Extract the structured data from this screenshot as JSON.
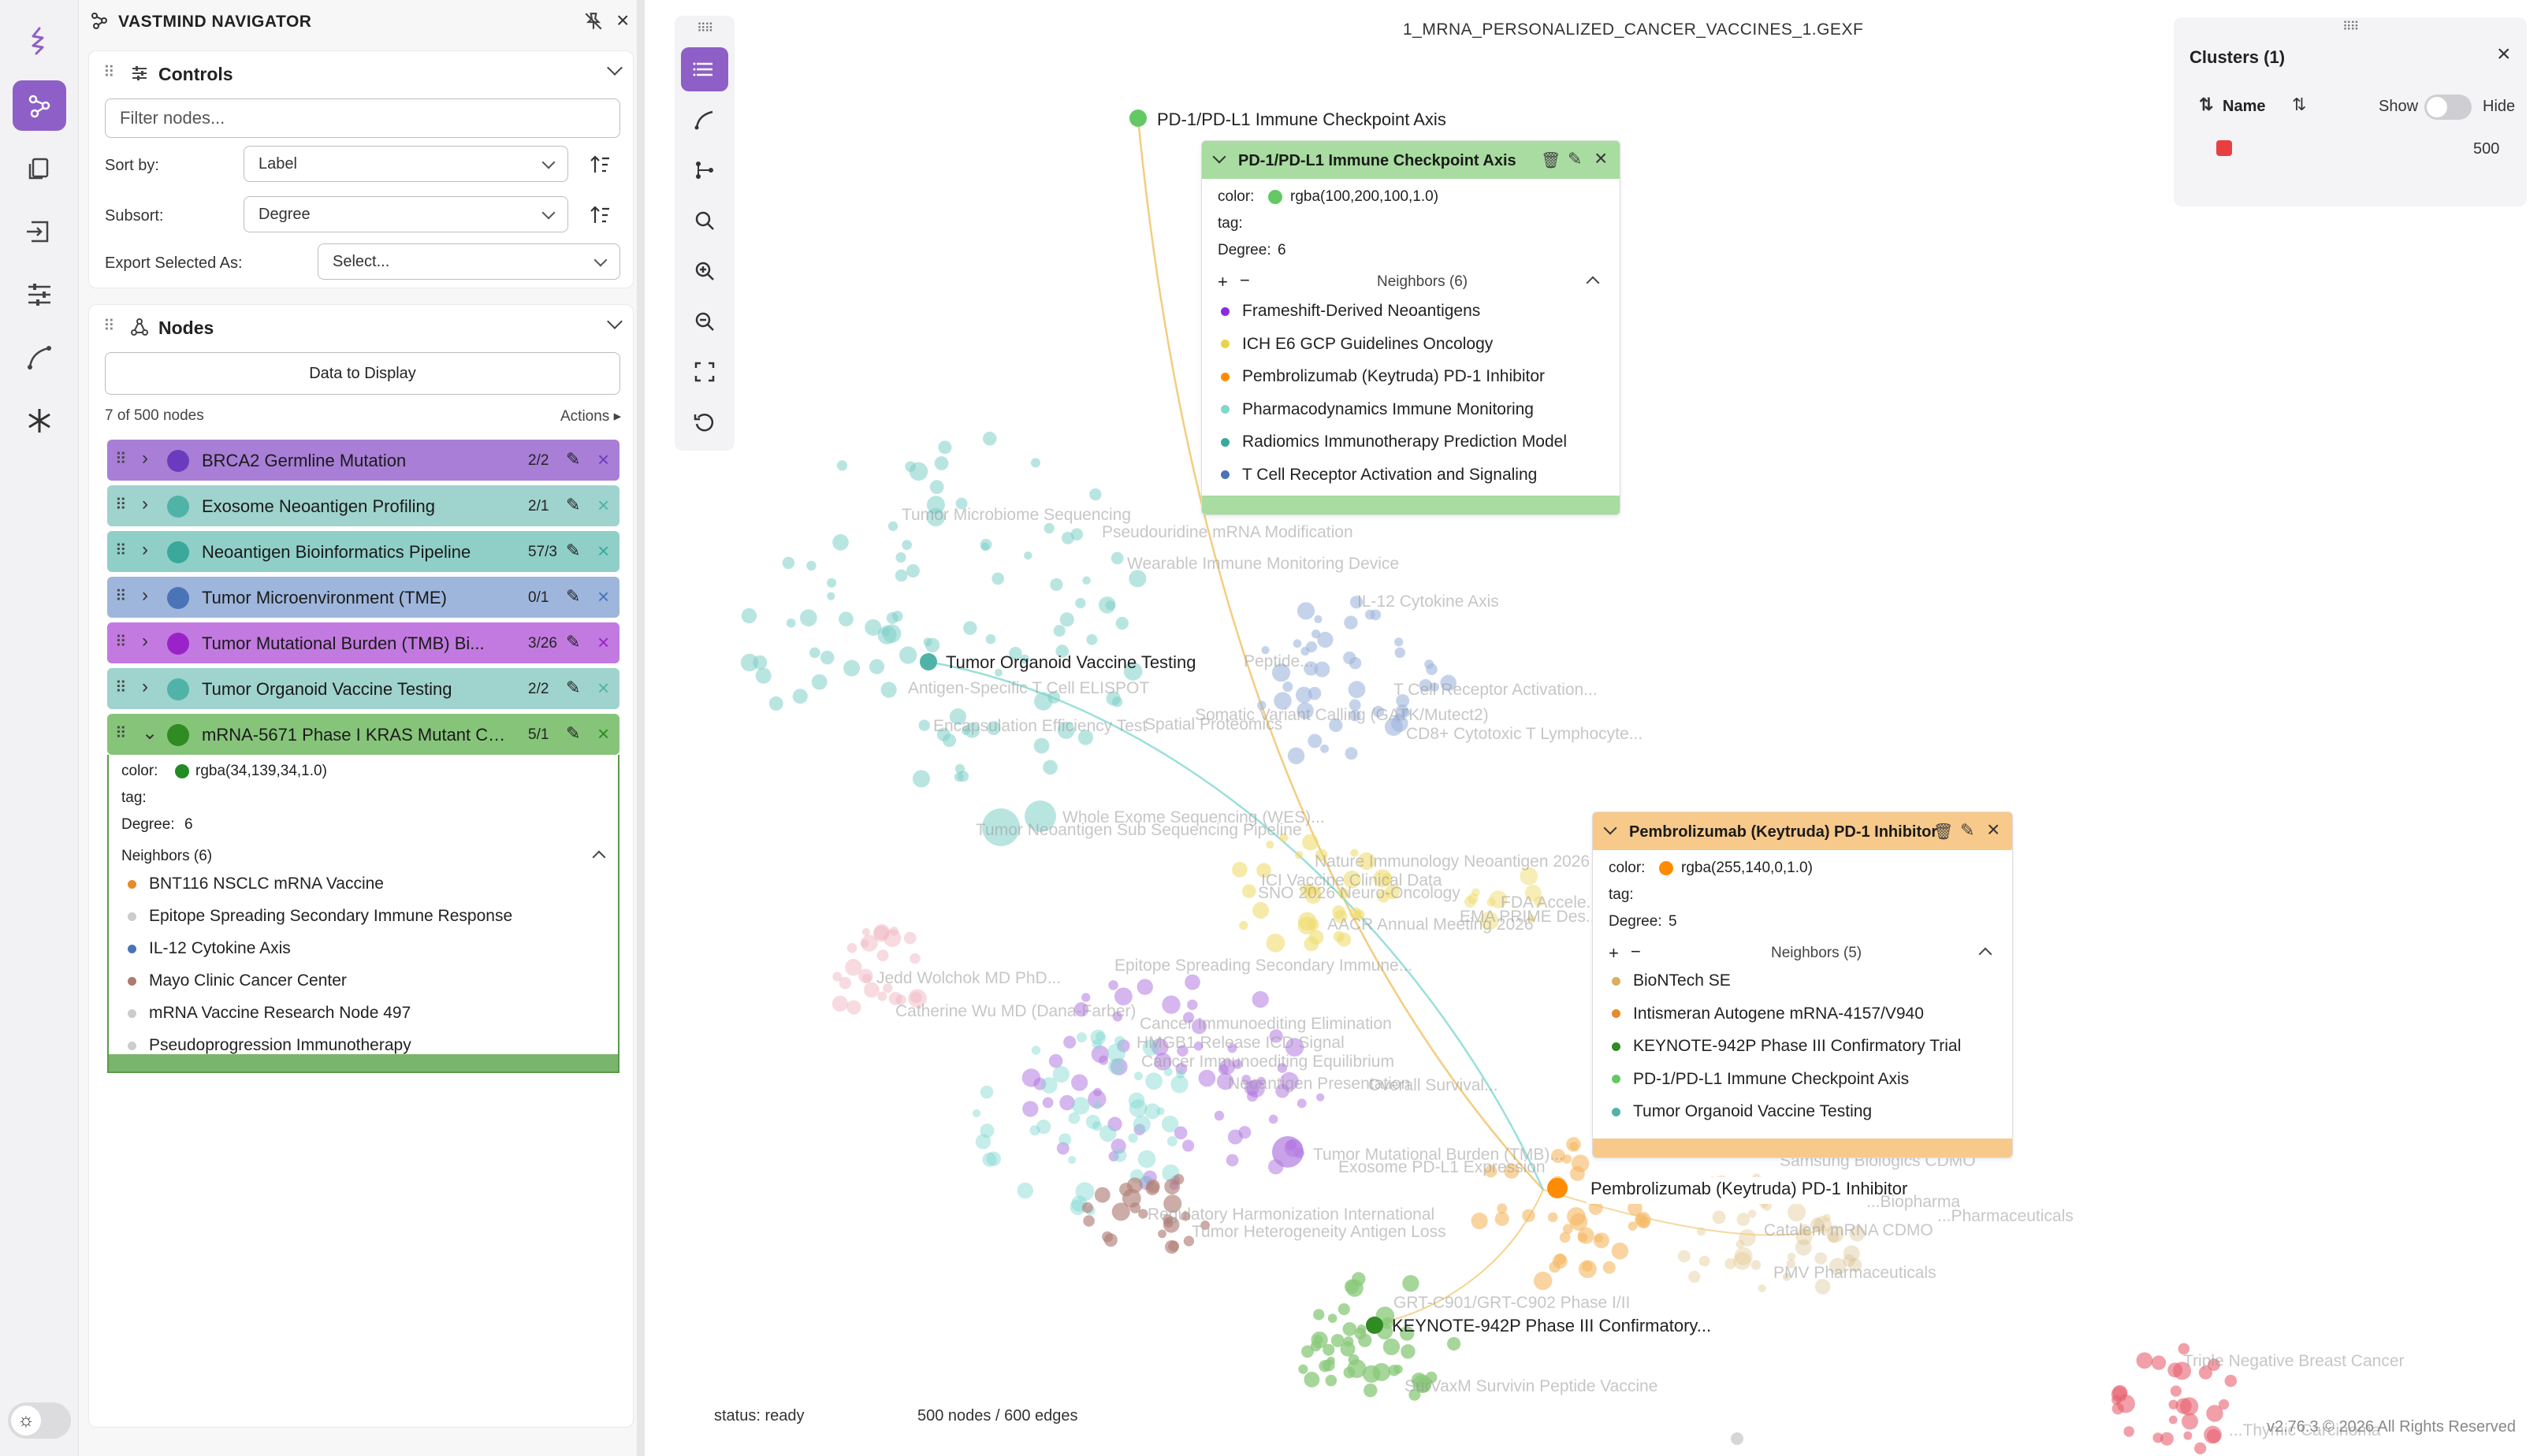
{
  "app": {
    "name": "VASTMIND NAVIGATOR",
    "file_title": "1_MRNA_PERSONALIZED_CANCER_VACCINES_1.GEXF",
    "status": "status: ready",
    "counts": "500 nodes / 600 edges",
    "copyright": "v2.76.3 © 2026 All Rights Reserved"
  },
  "rail": [
    "logo-icon",
    "graph-icon",
    "copy-icon",
    "import-icon",
    "sliders-icon",
    "curve-icon",
    "asterisk-icon"
  ],
  "controls": {
    "title": "Controls",
    "filter_placeholder": "Filter nodes...",
    "sort_by_label": "Sort by:",
    "sort_by_value": "Label",
    "subsort_label": "Subsort:",
    "subsort_value": "Degree",
    "export_label": "Export Selected As:",
    "export_value": "Select..."
  },
  "nodes_panel": {
    "title": "Nodes",
    "data_button": "Data to Display",
    "count_text": "7 of 500 nodes",
    "actions": "Actions ▸",
    "rows": [
      {
        "name": "BRCA2 Germline Mutation",
        "count": "2/2",
        "bg": "#a87ed6",
        "dot": "#6b3bbf",
        "x": "#6b3bbf"
      },
      {
        "name": "Exosome Neoantigen Profiling",
        "count": "2/1",
        "bg": "#9fd3cd",
        "dot": "#4fb3a8",
        "x": "#4fb3a8"
      },
      {
        "name": "Neoantigen Bioinformatics Pipeline",
        "count": "57/3",
        "bg": "#8fcfc8",
        "dot": "#3aa89b",
        "x": "#3aa89b"
      },
      {
        "name": "Tumor Microenvironment (TME)",
        "count": "0/1",
        "bg": "#9fb6dc",
        "dot": "#4a73b8",
        "x": "#4a73b8"
      },
      {
        "name": "Tumor Mutational Burden (TMB) Bi...",
        "count": "3/26",
        "bg": "#c27ae0",
        "dot": "#9a22c9",
        "x": "#9a22c9"
      },
      {
        "name": "Tumor Organoid Vaccine Testing",
        "count": "2/2",
        "bg": "#9fd3cd",
        "dot": "#4fb3a8",
        "x": "#4fb3a8"
      },
      {
        "name": "mRNA-5671 Phase I KRAS Mutant Ca...",
        "count": "5/1",
        "bg": "#86c47a",
        "dot": "#2f8b22",
        "x": "#2f8b22"
      }
    ],
    "detail": {
      "color_label": "color:",
      "color_value": "rgba(34,139,34,1.0)",
      "tag_label": "tag:",
      "degree_label": "Degree:",
      "degree_value": "6",
      "neighbors_title": "Neighbors (6)",
      "neighbors": [
        {
          "name": "BNT116 NSCLC mRNA Vaccine",
          "color": "#e88a2b"
        },
        {
          "name": "Epitope Spreading Secondary Immune Response",
          "color": "#cccccc"
        },
        {
          "name": "IL-12 Cytokine Axis",
          "color": "#4a73b8"
        },
        {
          "name": "Mayo Clinic Cancer Center",
          "color": "#b07a70"
        },
        {
          "name": "mRNA Vaccine Research Node 497",
          "color": "#cccccc"
        },
        {
          "name": "Pseudoprogression Immunotherapy",
          "color": "#cccccc"
        }
      ]
    }
  },
  "popup_pd1": {
    "title": "PD-1/PD-L1 Immune Checkpoint Axis",
    "color_label": "color:",
    "color_value": "rgba(100,200,100,1.0)",
    "tag_label": "tag:",
    "degree_label": "Degree:",
    "degree_value": "6",
    "neighbors_title": "Neighbors (6)",
    "neighbors": [
      {
        "name": "Frameshift-Derived Neoantigens",
        "color": "#8a2be2"
      },
      {
        "name": "ICH E6 GCP Guidelines Oncology",
        "color": "#e8d44a"
      },
      {
        "name": "Pembrolizumab (Keytruda) PD-1 Inhibitor",
        "color": "#ff8c00"
      },
      {
        "name": "Pharmacodynamics Immune Monitoring",
        "color": "#7fd8d0"
      },
      {
        "name": "Radiomics Immunotherapy Prediction Model",
        "color": "#3aa89b"
      },
      {
        "name": "T Cell Receptor Activation and Signaling",
        "color": "#4a73b8"
      }
    ]
  },
  "popup_pembro": {
    "title": "Pembrolizumab (Keytruda) PD-1 Inhibitor",
    "color_label": "color:",
    "color_value": "rgba(255,140,0,1.0)",
    "tag_label": "tag:",
    "degree_label": "Degree:",
    "degree_value": "5",
    "neighbors_title": "Neighbors (5)",
    "neighbors": [
      {
        "name": "BioNTech SE",
        "color": "#d8b060"
      },
      {
        "name": "Intismeran Autogene mRNA-4157/V940",
        "color": "#e88a2b"
      },
      {
        "name": "KEYNOTE-942P Phase III Confirmatory Trial",
        "color": "#2f8b22"
      },
      {
        "name": "PD-1/PD-L1 Immune Checkpoint Axis",
        "color": "#64c864"
      },
      {
        "name": "Tumor Organoid Vaccine Testing",
        "color": "#4fb3a8"
      }
    ]
  },
  "clusters": {
    "title": "Clusters (1)",
    "name_col": "Name",
    "show": "Show",
    "hide": "Hide",
    "value": "500",
    "swatch": "#e84040"
  },
  "graph_labels": {
    "pd1": "PD-1/PD-L1 Immune Checkpoint Axis",
    "organoid": "Tumor Organoid Vaccine Testing",
    "pembro": "Pembrolizumab (Keytruda) PD-1 Inhibitor",
    "keynote": "KEYNOTE-942P Phase III Confirmatory...",
    "faint": [
      "Tumor Microbiome Sequencing",
      "Pseudouridine mRNA Modification",
      "Wearable Immune Monitoring Device",
      "IL-12 Cytokine Axis",
      "Antigen-Specific T Cell ELISPOT",
      "Peptide...",
      "Encapsulation Efficiency Test",
      "Spatial Proteomics",
      "Somatic Variant Calling (GATK/Mutect2)",
      "T Cell Receptor Activation...",
      "CD8+ Cytotoxic T Lymphocyte...",
      "Whole Exome Sequencing (WES)...",
      "Tumor Neoantigen Sub Sequencing Pipeline",
      "Nature Immunology Neoantigen 2026",
      "ICI Vaccine Clinical Data",
      "SNO 2026 Neuro-Oncology",
      "AACR Annual Meeting 2026",
      "FDA Accele...",
      "EMA PRIME Des...",
      "Jedd Wolchok MD PhD...",
      "Catherine Wu MD (Dana-Farber)",
      "Epitope Spreading Secondary Immune...",
      "Cancer Immunoediting Elimination",
      "HMGB1 Release ICD Signal",
      "Cancer Immunoediting Equilibrium",
      "Neoantigen Presentation",
      "Overall Survival...",
      "Tumor Mutational Burden (TMB)...",
      "Exosome PD-L1 Expression",
      "Regulatory Harmonization International",
      "Tumor Heterogeneity Antigen Loss",
      "Samsung Biologics CDMO",
      "...Biopharma",
      "...Pharmaceuticals",
      "Catalent mRNA CDMO",
      "PMV Pharmaceuticals",
      "GRT-C901/GRT-C902 Phase I/II",
      "SurVaxM Survivin Peptide Vaccine",
      "Triple Negative Breast Cancer",
      "...Thymic Carcinoma"
    ]
  }
}
